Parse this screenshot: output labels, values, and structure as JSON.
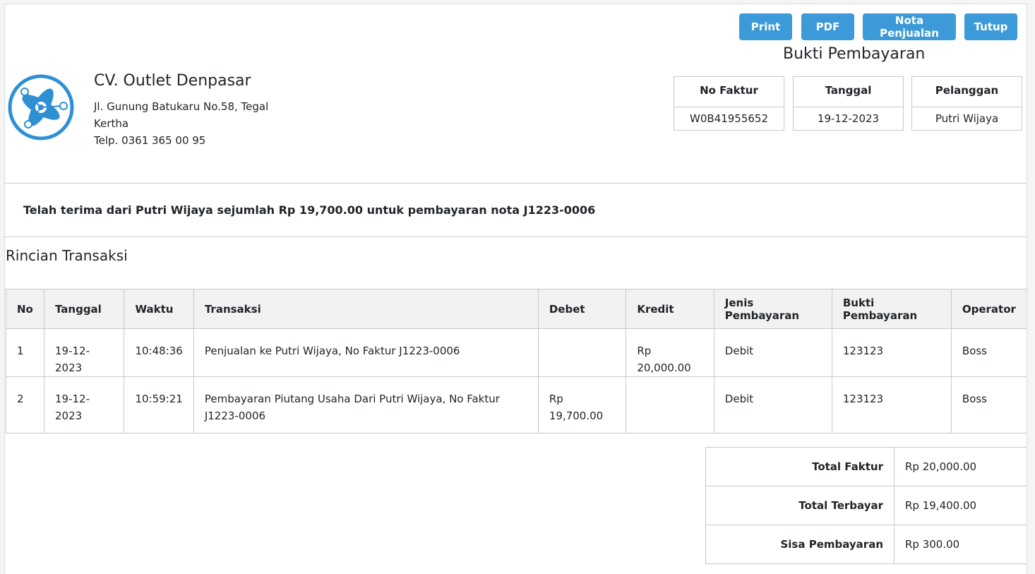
{
  "toolbar": {
    "print_label": "Print",
    "pdf_label": "PDF",
    "nota_label": "Nota Penjualan",
    "tutup_label": "Tutup"
  },
  "company": {
    "name": "CV. Outlet Denpasar",
    "address": "Jl. Gunung Batukaru No.58, Tegal Kertha",
    "phone": "Telp. 0361 365 00 95",
    "logo_icon": "atom-logo-icon",
    "logo_color": "#2e90d3"
  },
  "document": {
    "title": "Bukti Pembayaran",
    "no_faktur_label": "No Faktur",
    "no_faktur_value": "W0B41955652",
    "tanggal_label": "Tanggal",
    "tanggal_value": "19-12-2023",
    "pelanggan_label": "Pelanggan",
    "pelanggan_value": "Putri Wijaya"
  },
  "receipt_text": "Telah terima dari Putri Wijaya sejumlah Rp 19,700.00 untuk pembayaran nota J1223-0006",
  "transactions": {
    "title": "Rincian Transaksi",
    "headers": [
      "No",
      "Tanggal",
      "Waktu",
      "Transaksi",
      "Debet",
      "Kredit",
      "Jenis Pembayaran",
      "Bukti Pembayaran",
      "Operator"
    ],
    "rows": [
      [
        "1",
        "19-12-2023",
        "10:48:36",
        "Penjualan ke Putri Wijaya, No Faktur J1223-0006",
        "",
        "Rp 20,000.00",
        "Debit",
        "123123",
        "Boss"
      ],
      [
        "2",
        "19-12-2023",
        "10:59:21",
        "Pembayaran Piutang Usaha Dari Putri Wijaya, No Faktur J1223-0006",
        "Rp 19,700.00",
        "",
        "Debit",
        "123123",
        "Boss"
      ]
    ]
  },
  "summary": {
    "total_faktur_label": "Total Faktur",
    "total_faktur_value": "Rp 20,000.00",
    "total_terbayar_label": "Total Terbayar",
    "total_terbayar_value": "Rp 19,400.00",
    "sisa_label": "Sisa Pembayaran",
    "sisa_value": "Rp 300.00"
  },
  "colors": {
    "button": "#3d9ad8",
    "header_bg": "#f2f2f2",
    "border": "#c8c8c8"
  }
}
